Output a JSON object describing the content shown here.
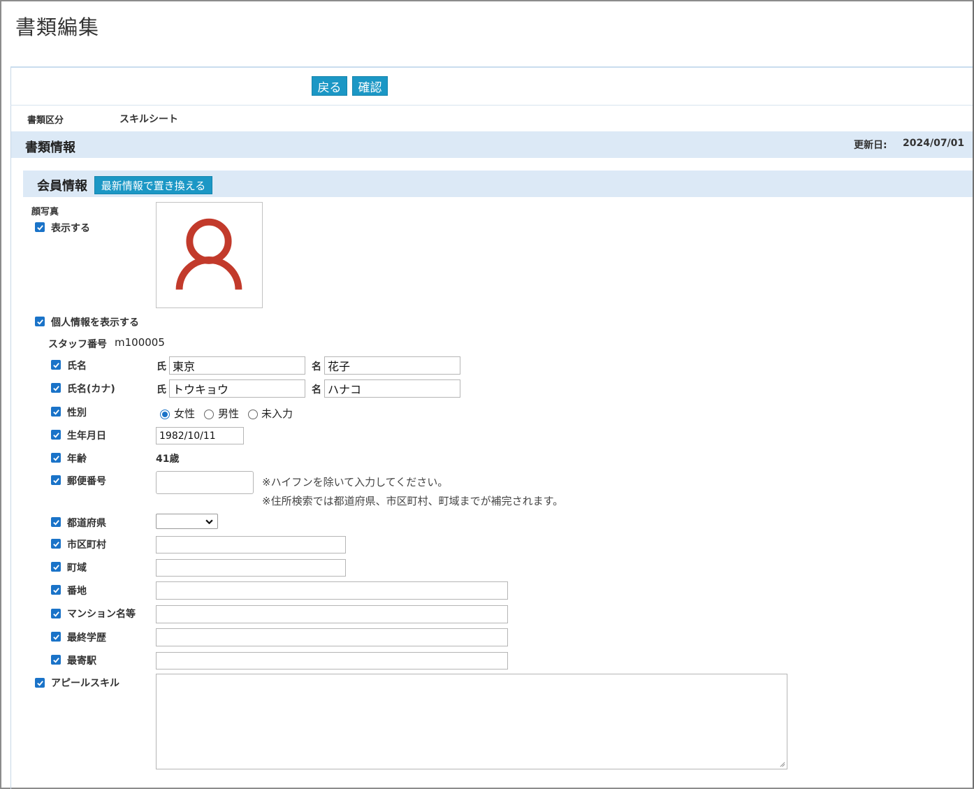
{
  "page_title": "書類編集",
  "toolbar": {
    "back_label": "戻る",
    "confirm_label": "確認"
  },
  "doc_type": {
    "label": "書類区分",
    "value": "スキルシート"
  },
  "doc_info": {
    "title": "書類情報",
    "updated_label": "更新日:",
    "updated_value": "2024/07/01"
  },
  "member": {
    "title": "会員情報",
    "replace_label": "最新情報で置き換える",
    "photo_label": "顔写真",
    "photo_show_label": "表示する",
    "personal_show_label": "個人情報を表示する",
    "staff_no_label": "スタッフ番号",
    "staff_no_value": "m100005",
    "fields": {
      "name": {
        "label": "氏名",
        "last_prefix": "氏",
        "last_value": "東京",
        "first_prefix": "名",
        "first_value": "花子"
      },
      "kana": {
        "label": "氏名(カナ)",
        "last_prefix": "氏",
        "last_value": "トウキョウ",
        "first_prefix": "名",
        "first_value": "ハナコ"
      },
      "gender": {
        "label": "性別",
        "options": [
          "女性",
          "男性",
          "未入力"
        ],
        "selected": "女性"
      },
      "birthday": {
        "label": "生年月日",
        "value": "1982/10/11"
      },
      "age": {
        "label": "年齢",
        "value": "41歳"
      },
      "postal": {
        "label": "郵便番号",
        "value": "",
        "note1": "※ハイフンを除いて入力してください。",
        "note2": "※住所検索では都道府県、市区町村、町域までが補完されます。"
      },
      "prefecture": {
        "label": "都道府県",
        "value": ""
      },
      "city": {
        "label": "市区町村",
        "value": ""
      },
      "town": {
        "label": "町域",
        "value": ""
      },
      "block": {
        "label": "番地",
        "value": ""
      },
      "building": {
        "label": "マンション名等",
        "value": ""
      },
      "education": {
        "label": "最終学歴",
        "value": ""
      },
      "station": {
        "label": "最寄駅",
        "value": ""
      },
      "appeal": {
        "label": "アピールスキル",
        "value": ""
      }
    }
  },
  "colors": {
    "accent": "#1b97c5",
    "checkbox": "#1a73c8",
    "section_bg": "#dce9f6",
    "avatar": "#c23a2b"
  },
  "icons": {
    "checkbox": "check-icon",
    "avatar": "user-avatar-icon",
    "select": "chevron-down-icon"
  }
}
